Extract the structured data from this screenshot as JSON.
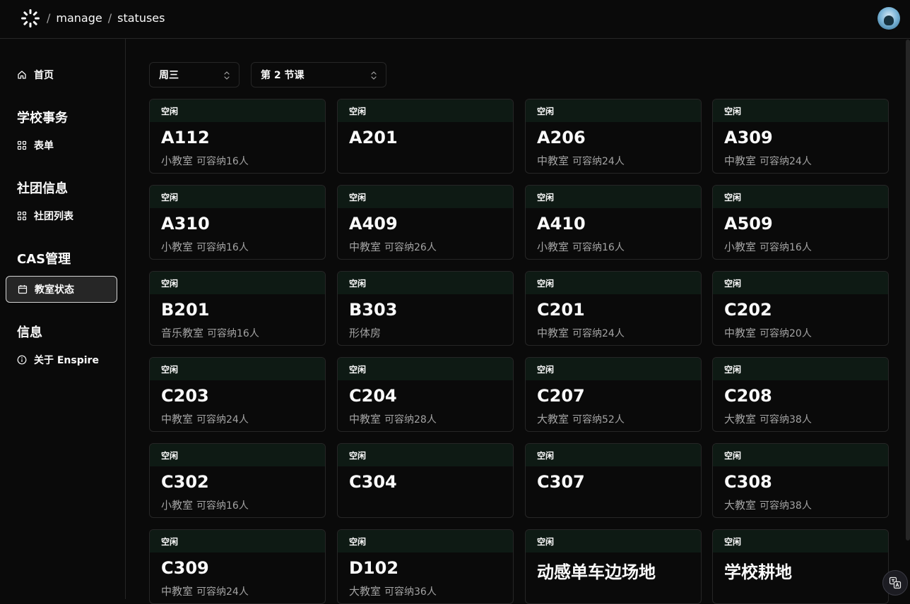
{
  "breadcrumb": [
    "manage",
    "statuses"
  ],
  "sidebar": {
    "home": "首页",
    "groups": [
      {
        "title": "学校事务",
        "items": [
          {
            "label": "表单",
            "icon": "grid-icon"
          }
        ]
      },
      {
        "title": "社团信息",
        "items": [
          {
            "label": "社团列表",
            "icon": "grid-icon"
          }
        ]
      },
      {
        "title": "CAS管理",
        "items": [
          {
            "label": "教室状态",
            "icon": "calendar-icon",
            "active": true
          }
        ]
      },
      {
        "title": "信息",
        "items": [
          {
            "label": "关于 Enspire",
            "icon": "info-icon"
          }
        ]
      }
    ]
  },
  "filters": {
    "day": "周三",
    "period": "第 2 节课"
  },
  "rooms": [
    {
      "status": "空闲",
      "name": "A112",
      "type": "小教室",
      "capacity": "可容纳16人"
    },
    {
      "status": "空闲",
      "name": "A201",
      "type": "",
      "capacity": ""
    },
    {
      "status": "空闲",
      "name": "A206",
      "type": "中教室",
      "capacity": "可容纳24人"
    },
    {
      "status": "空闲",
      "name": "A309",
      "type": "中教室",
      "capacity": "可容纳24人"
    },
    {
      "status": "空闲",
      "name": "A310",
      "type": "小教室",
      "capacity": "可容纳16人"
    },
    {
      "status": "空闲",
      "name": "A409",
      "type": "中教室",
      "capacity": "可容纳26人"
    },
    {
      "status": "空闲",
      "name": "A410",
      "type": "小教室",
      "capacity": "可容纳16人"
    },
    {
      "status": "空闲",
      "name": "A509",
      "type": "小教室",
      "capacity": "可容纳16人"
    },
    {
      "status": "空闲",
      "name": "B201",
      "type": "音乐教室",
      "capacity": "可容纳16人"
    },
    {
      "status": "空闲",
      "name": "B303",
      "type": "形体房",
      "capacity": ""
    },
    {
      "status": "空闲",
      "name": "C201",
      "type": "中教室",
      "capacity": "可容纳24人"
    },
    {
      "status": "空闲",
      "name": "C202",
      "type": "中教室",
      "capacity": "可容纳20人"
    },
    {
      "status": "空闲",
      "name": "C203",
      "type": "中教室",
      "capacity": "可容纳24人"
    },
    {
      "status": "空闲",
      "name": "C204",
      "type": "中教室",
      "capacity": "可容纳28人"
    },
    {
      "status": "空闲",
      "name": "C207",
      "type": "大教室",
      "capacity": "可容纳52人"
    },
    {
      "status": "空闲",
      "name": "C208",
      "type": "大教室",
      "capacity": "可容纳38人"
    },
    {
      "status": "空闲",
      "name": "C302",
      "type": "小教室",
      "capacity": "可容纳16人"
    },
    {
      "status": "空闲",
      "name": "C304",
      "type": "",
      "capacity": ""
    },
    {
      "status": "空闲",
      "name": "C307",
      "type": "",
      "capacity": ""
    },
    {
      "status": "空闲",
      "name": "C308",
      "type": "大教室",
      "capacity": "可容纳38人"
    },
    {
      "status": "空闲",
      "name": "C309",
      "type": "中教室",
      "capacity": "可容纳24人"
    },
    {
      "status": "空闲",
      "name": "D102",
      "type": "大教室",
      "capacity": "可容纳36人"
    },
    {
      "status": "空闲",
      "name": "动感单车边场地",
      "type": "",
      "capacity": ""
    },
    {
      "status": "空闲",
      "name": "学校耕地",
      "type": "",
      "capacity": ""
    }
  ]
}
